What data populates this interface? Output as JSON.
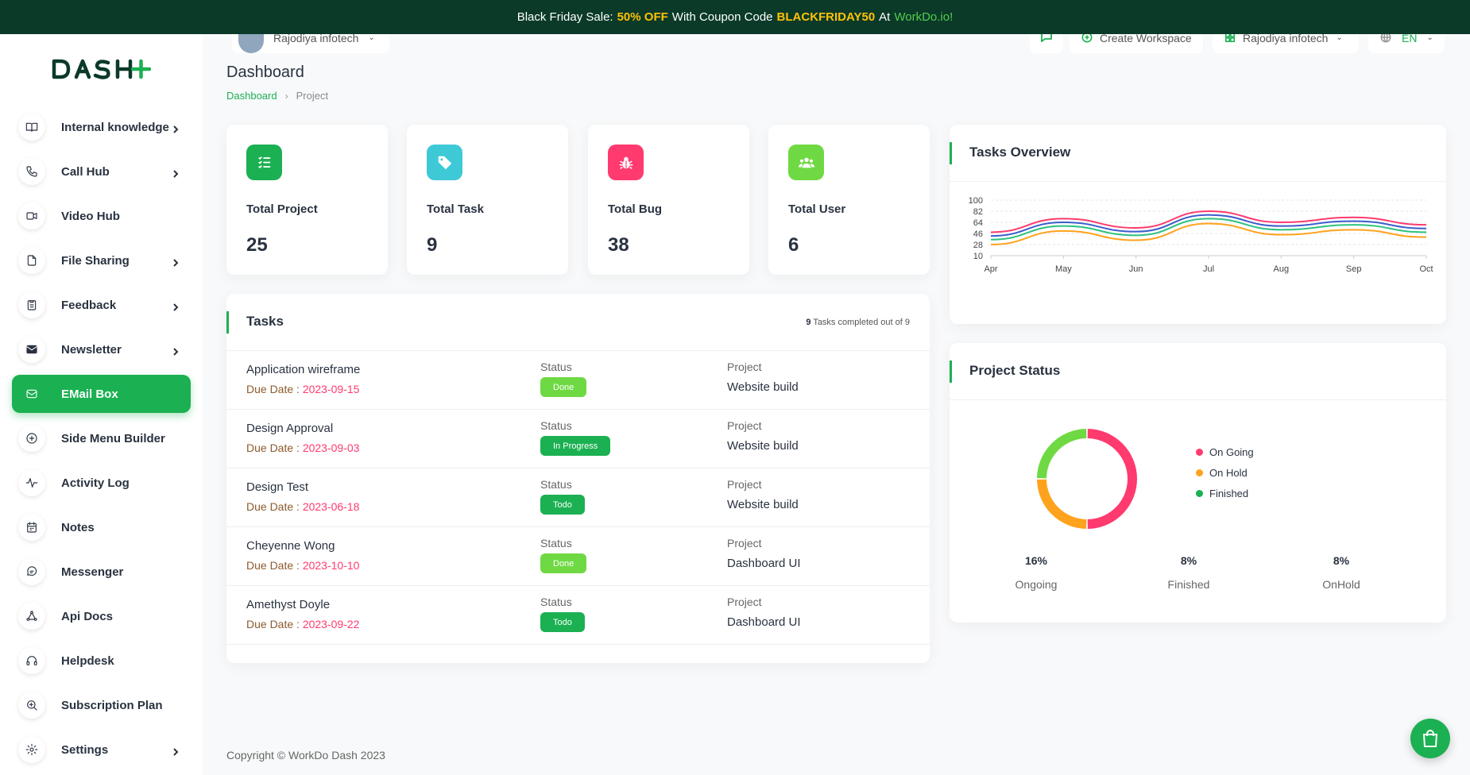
{
  "promo": {
    "prefix": "Black Friday Sale:",
    "discount": "50% OFF",
    "middle": "With Coupon Code",
    "code": "BLACKFRIDAY50",
    "at": "At",
    "site": "WorkDo.io!"
  },
  "header": {
    "workspace_selector": "Rajodiya infotech",
    "create_workspace": "Create Workspace",
    "user_name": "Rajodiya infotech",
    "language": "EN"
  },
  "sidebar": {
    "items": [
      {
        "label": "Internal knowledge",
        "icon": "book-icon"
      },
      {
        "label": "Call Hub",
        "icon": "phone-icon"
      },
      {
        "label": "Video Hub",
        "icon": "video-icon"
      },
      {
        "label": "File Sharing",
        "icon": "file-icon"
      },
      {
        "label": "Feedback",
        "icon": "clipboard-icon"
      },
      {
        "label": "Newsletter",
        "icon": "envelope-icon"
      },
      {
        "label": "EMail Box",
        "icon": "mail-icon"
      },
      {
        "label": "Side Menu Builder",
        "icon": "plus-circle-icon"
      },
      {
        "label": "Activity Log",
        "icon": "activity-icon"
      },
      {
        "label": "Notes",
        "icon": "calendar-icon"
      },
      {
        "label": "Messenger",
        "icon": "chat-icon"
      },
      {
        "label": "Api Docs",
        "icon": "nodes-icon"
      },
      {
        "label": "Helpdesk",
        "icon": "headphones-icon"
      },
      {
        "label": "Subscription Plan",
        "icon": "search-plan-icon"
      },
      {
        "label": "Settings",
        "icon": "gear-icon"
      }
    ]
  },
  "page": {
    "title": "Dashboard",
    "breadcrumb": [
      "Dashboard",
      "Project"
    ]
  },
  "stats": [
    {
      "label": "Total Project",
      "value": "25",
      "color": "#1bb052",
      "icon": "list-icon"
    },
    {
      "label": "Total Task",
      "value": "9",
      "color": "#3ec9d6",
      "icon": "tag-icon"
    },
    {
      "label": "Total Bug",
      "value": "38",
      "color": "#ff3a6e",
      "icon": "bug-icon"
    },
    {
      "label": "Total User",
      "value": "6",
      "color": "#6fd943",
      "icon": "users-icon"
    }
  ],
  "tasks": {
    "title": "Tasks",
    "completed_count": "9",
    "completed_text": "Tasks completed out of 9",
    "status_label": "Status",
    "project_label": "Project",
    "due_label": "Due Date :",
    "rows": [
      {
        "name": "Application wireframe",
        "due": "2023-09-15",
        "status": "Done",
        "status_color": "#6fd943",
        "project": "Website build"
      },
      {
        "name": "Design Approval",
        "due": "2023-09-03",
        "status": "In Progress",
        "status_color": "#1bb052",
        "project": "Website build"
      },
      {
        "name": "Design Test",
        "due": "2023-06-18",
        "status": "Todo",
        "status_color": "#1bb052",
        "project": "Website build"
      },
      {
        "name": "Cheyenne Wong",
        "due": "2023-10-10",
        "status": "Done",
        "status_color": "#6fd943",
        "project": "Dashboard UI"
      },
      {
        "name": "Amethyst Doyle",
        "due": "2023-09-22",
        "status": "Todo",
        "status_color": "#1bb052",
        "project": "Dashboard UI"
      }
    ]
  },
  "overview": {
    "title": "Tasks Overview"
  },
  "chart_data": [
    {
      "type": "line",
      "x": [
        "Apr",
        "May",
        "Jun",
        "Jul",
        "Aug",
        "Sep",
        "Oct"
      ],
      "y_ticks": [
        10,
        28,
        46,
        64,
        82,
        100
      ],
      "ylim": [
        10,
        100
      ],
      "grid": true,
      "series": [
        {
          "color": "#ff3a6e",
          "values": [
            48,
            70,
            55,
            82,
            64,
            72,
            60
          ]
        },
        {
          "color": "#3b5ccc",
          "values": [
            42,
            64,
            49,
            76,
            58,
            66,
            54
          ]
        },
        {
          "color": "#2ec27e",
          "values": [
            36,
            58,
            43,
            70,
            52,
            60,
            48
          ]
        },
        {
          "color": "#ffa21d",
          "values": [
            28,
            50,
            35,
            62,
            44,
            52,
            40
          ]
        }
      ]
    },
    {
      "type": "pie",
      "title": "Project Status",
      "labels": [
        "On Going",
        "On Hold",
        "Finished"
      ],
      "values": [
        16,
        8,
        8
      ],
      "colors": [
        "#ff3a6e",
        "#ffa21d",
        "#6fd943"
      ]
    }
  ],
  "project_status": {
    "title": "Project Status",
    "legend": [
      "On Going",
      "On Hold",
      "Finished"
    ],
    "stats": [
      {
        "value": "16%",
        "label": "Ongoing"
      },
      {
        "value": "8%",
        "label": "Finished"
      },
      {
        "value": "8%",
        "label": "OnHold"
      }
    ]
  },
  "footer": {
    "copyright": "Copyright © WorkDo Dash 2023"
  }
}
